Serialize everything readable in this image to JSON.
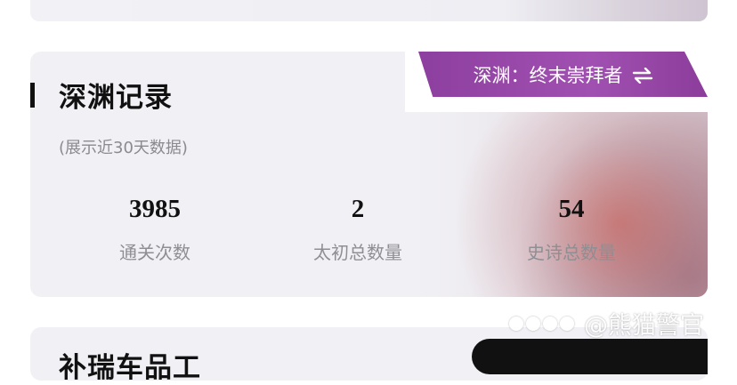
{
  "abyss": {
    "title": "深渊记录",
    "realm_button": "深渊：终末崇拜者",
    "subtitle": "(展示近30天数据)",
    "stats": [
      {
        "value": "3985",
        "label": "通关次数"
      },
      {
        "value": "2",
        "label": "太初总数量"
      },
      {
        "value": "54",
        "label": "史诗总数量"
      }
    ]
  },
  "next_section": {
    "title": "补瑞车品工"
  },
  "watermark": "@熊猫警官",
  "colors": {
    "accent": "#9a4aab",
    "card_bg": "#f1f1f5",
    "title": "#111111",
    "muted": "#8e8e93"
  }
}
